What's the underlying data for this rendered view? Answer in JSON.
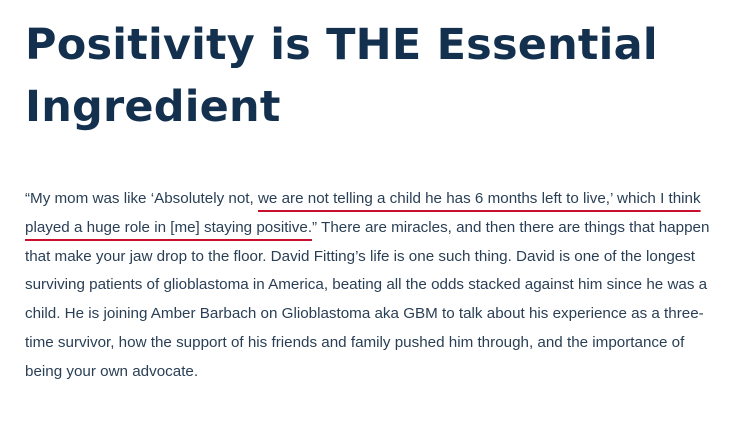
{
  "article": {
    "title": "Positivity is THE Essential Ingredient",
    "quote_open": "“My mom was like ‘Absolutely not, ",
    "quote_highlight": "we are not telling a child he has 6 months left to live,’ which I think played a huge role in [me] staying positive.",
    "quote_close": "”",
    "body_rest": " There are miracles, and then there are things that happen that make your jaw drop to the floor. David Fitting’s life is one such thing. David is one of the longest surviving patients of glioblastoma in America, beating all the odds stacked against him since he was a child. He is joining Amber Barbach on Glioblastoma aka GBM to talk about his experience as a three-time survivor, how the support of his friends and family pushed him through, and the importance of being your own advocate.",
    "colors": {
      "title": "#14304f",
      "body": "#2a3f55",
      "underline_accent": "#c8102e"
    }
  }
}
